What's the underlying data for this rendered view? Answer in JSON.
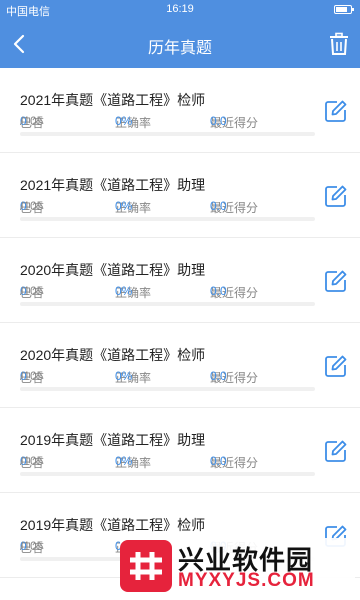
{
  "statusbar": {
    "carrier": "中国电信",
    "time": "16:19"
  },
  "header": {
    "title": "历年真题"
  },
  "labels": {
    "answered": "已答",
    "accuracy": "正确率",
    "recent_score": "最近得分"
  },
  "items": [
    {
      "title": "2021年真题《道路工程》检师",
      "answered": "0",
      "total": "/105",
      "accuracy": "0%",
      "score": "0.0"
    },
    {
      "title": "2021年真题《道路工程》助理",
      "answered": "0",
      "total": "/105",
      "accuracy": "0%",
      "score": "0.0"
    },
    {
      "title": "2020年真题《道路工程》助理",
      "answered": "0",
      "total": "/105",
      "accuracy": "0%",
      "score": "0.0"
    },
    {
      "title": "2020年真题《道路工程》检师",
      "answered": "0",
      "total": "/105",
      "accuracy": "0%",
      "score": "0.0"
    },
    {
      "title": "2019年真题《道路工程》助理",
      "answered": "0",
      "total": "/105",
      "accuracy": "0%",
      "score": "0.0"
    },
    {
      "title": "2019年真题《道路工程》检师",
      "answered": "0",
      "total": "/105",
      "accuracy": "0%",
      "score": "0.0"
    }
  ],
  "watermark": {
    "cn": "兴业软件园",
    "en": "MYXYJS.COM"
  },
  "colors": {
    "primary": "#4f8fe0",
    "accent_text": "#3e8ee8",
    "watermark": "#e6233c"
  },
  "icons": {
    "back": "chevron-left-icon",
    "trash": "trash-icon",
    "edit": "edit-icon"
  }
}
